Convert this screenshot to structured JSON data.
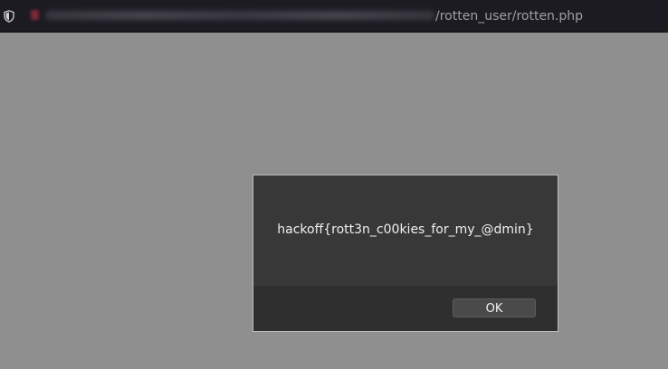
{
  "browser": {
    "url_visible_path": "/rotten_user/rotten.php",
    "security_icon": "shield-icon"
  },
  "dialog": {
    "message": "hackoff{rott3n_c00kies_for_my_@dmin}",
    "ok_label": "OK"
  },
  "colors": {
    "page_background": "#8f8f8f",
    "urlbar_background": "#1c1b22",
    "dialog_background": "#383838",
    "dialog_footer": "#2f2f2f"
  }
}
